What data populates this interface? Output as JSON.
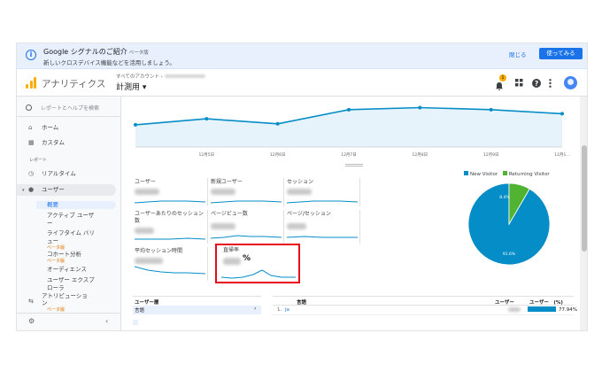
{
  "banner": {
    "info_icon": "info-icon",
    "title": "Google シグナルのご紹介",
    "beta": "ベータ版",
    "subtitle": "新しいクロスデバイス機能などを活用しましょう。",
    "close_label": "閉じる",
    "try_label": "使ってみる"
  },
  "header": {
    "app_title": "アナリティクス",
    "breadcrumb": "すべてのアカウント ›",
    "view_name": "計測用 ▾",
    "notification_count": "1",
    "icons": [
      "bell-icon",
      "apps-icon",
      "help-icon",
      "more-vert-icon",
      "avatar-icon"
    ],
    "accent_color": "#f9ab00"
  },
  "sidebar": {
    "search_placeholder": "レポートとヘルプを検索",
    "home": "ホーム",
    "custom": "カスタム",
    "reports_section": "レポート",
    "realtime": "リアルタイム",
    "audience": "ユーザー",
    "sub_items": {
      "overview": "概要",
      "active_users": "アクティブ ユーザ",
      "active_users_cont": "ー",
      "lifetime": "ライフタイム バリ",
      "lifetime_cont": "ュー",
      "lifetime_beta": "ベータ版",
      "cohort": "コホート分析",
      "cohort_beta": "ベータ版",
      "audiences": "オーディエンス",
      "explorer": "ユーザー エクスプ",
      "explorer_cont": "ローラ"
    },
    "attribution": "アトリビューショ",
    "attribution_cont": "ン",
    "attribution_beta": "ベータ版"
  },
  "chart_data": {
    "type": "line",
    "x": [
      "",
      "12月5日",
      "12月6日",
      "12月7日",
      "12月8日",
      "12月9日",
      "12月1..."
    ],
    "series": [
      {
        "values": [
          52,
          58,
          53,
          67,
          69,
          67,
          63
        ]
      }
    ],
    "ylim": [
      30,
      80
    ],
    "grid": false,
    "color": "#058dc7"
  },
  "metrics": {
    "users": "ユーザー",
    "new_users": "新規ユーザー",
    "sessions": "セッション",
    "sessions_per_user_1": "ユーザーあたりのセッション",
    "sessions_per_user_2": "数",
    "pageviews": "ページビュー数",
    "pages_per_session": "ページ/セッション",
    "avg_session_duration": "平均セッション時間",
    "bounce_rate": "直帰率",
    "bounce_rate_unit": "%"
  },
  "pie_chart": {
    "legend_new": "New Visitor",
    "legend_returning": "Returning Visitor",
    "new_color": "#058dc7",
    "returning_color": "#50b432",
    "new_pct": 91.6,
    "returning_pct": 8.4,
    "new_label": "91.6%",
    "returning_label": "8.4%"
  },
  "table": {
    "left_header": "ユーザー層",
    "left_row": "言語",
    "left_row_arrow": "›",
    "right_header_lang": "言語",
    "right_header_users": "ユーザー",
    "right_header_pct": "ユーザー　(%)",
    "row_index": "1.",
    "row_lang": "ja",
    "row_pct": "77.94%"
  }
}
